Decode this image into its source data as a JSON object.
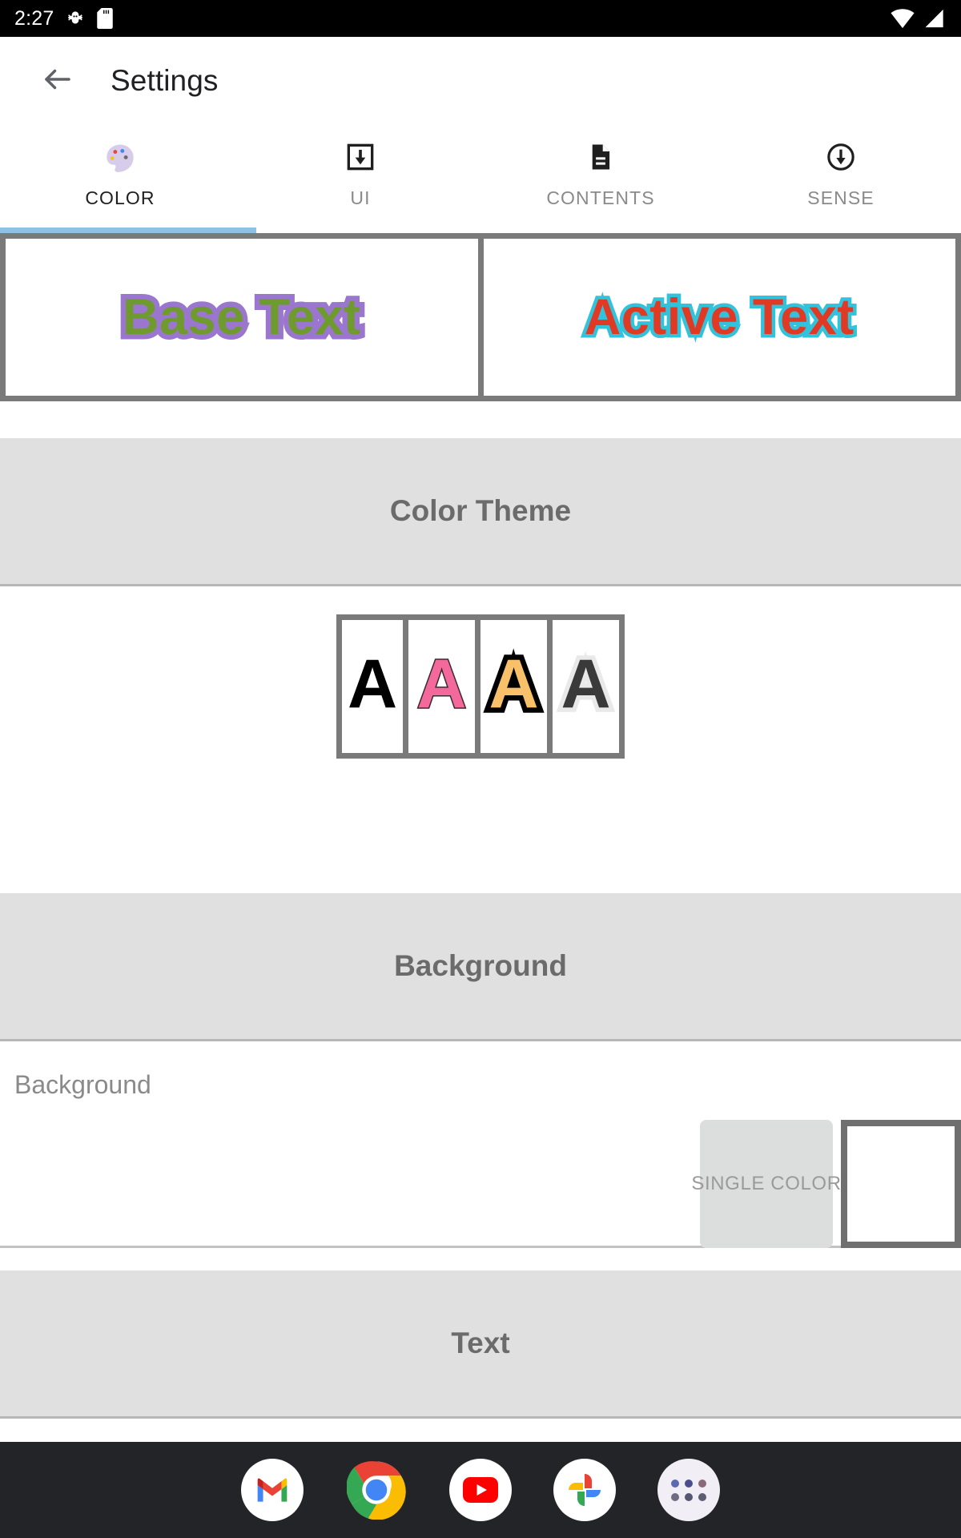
{
  "status_bar": {
    "time": "2:27",
    "left_icons": [
      "bug-icon",
      "sd-card-icon"
    ],
    "right_icons": [
      "wifi-icon",
      "signal-icon"
    ],
    "background_color": "#000000"
  },
  "app_bar": {
    "back_icon": "arrow-back-icon",
    "title": "Settings"
  },
  "tabs": {
    "active_index": 0,
    "indicator_color": "#8ec1e3",
    "items": [
      {
        "label": "COLOR",
        "icon": "palette-icon",
        "glyph": "🎨"
      },
      {
        "label": "UI",
        "icon": "download-box-icon",
        "glyph": ""
      },
      {
        "label": "CONTENTS",
        "icon": "document-icon",
        "glyph": ""
      },
      {
        "label": "SENSE",
        "icon": "circle-down-arrow-icon",
        "glyph": ""
      }
    ]
  },
  "preview": {
    "base": {
      "text": "Base Text",
      "fill_color": "#6f9a2e",
      "stroke_color": "#9a76cf"
    },
    "active": {
      "text": "Active Text",
      "fill_color": "#e03a25",
      "stroke_color": "#32c3dc"
    }
  },
  "sections": {
    "color_theme": {
      "title": "Color Theme",
      "swatches": [
        {
          "glyph": "A",
          "fill_color": "#000000",
          "stroke_color": "none"
        },
        {
          "glyph": "A",
          "fill_color": "#f4699c",
          "stroke_color": "#3a2a2f"
        },
        {
          "glyph": "A",
          "fill_color": "#f9c06a",
          "stroke_color": "#000000"
        },
        {
          "glyph": "A",
          "fill_color": "#3a3a3a",
          "stroke_color": "#e9e9e9"
        }
      ]
    },
    "background": {
      "title": "Background",
      "option_label": "Background",
      "mode_button_label": "SINGLE COLOR",
      "color_chip_value": "#ffffff"
    },
    "text": {
      "title": "Text"
    }
  },
  "dock": {
    "background_color": "#232427",
    "apps": [
      {
        "name": "gmail-icon"
      },
      {
        "name": "chrome-icon"
      },
      {
        "name": "youtube-icon"
      },
      {
        "name": "google-photos-icon"
      },
      {
        "name": "app-drawer-icon"
      }
    ]
  }
}
